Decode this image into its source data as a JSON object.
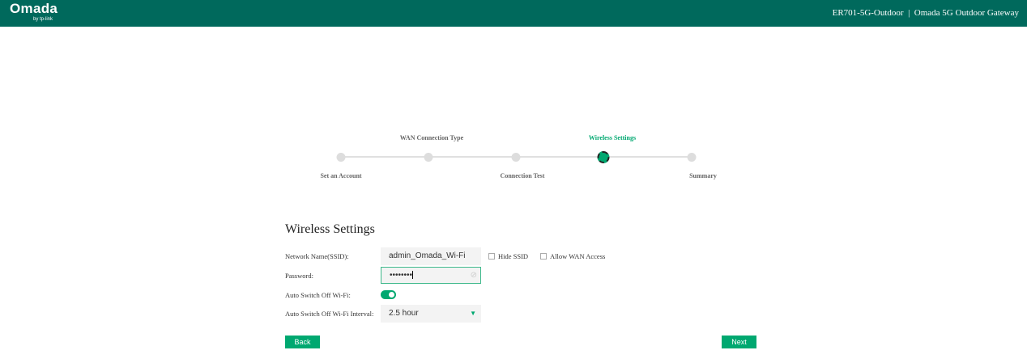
{
  "header": {
    "logo": "Omada",
    "logo_sub": "by tp-link",
    "device": "ER701-5G-Outdoor  |  Omada 5G Outdoor Gateway"
  },
  "steps": [
    {
      "label": "Set an Account"
    },
    {
      "label": "WAN Connection Type"
    },
    {
      "label": "Connection Test"
    },
    {
      "label": "Wireless Settings",
      "active": true
    },
    {
      "label": "Summary"
    }
  ],
  "form": {
    "title": "Wireless Settings",
    "ssid_label": "Network Name(SSID):",
    "ssid_value": "admin_Omada_Wi-Fi",
    "hide_ssid": "Hide SSID",
    "allow_wan": "Allow WAN Access",
    "password_label": "Password:",
    "password_value": "••••••••",
    "auto_off_label": "Auto Switch Off Wi-Fi:",
    "auto_off_on": true,
    "interval_label": "Auto Switch Off Wi-Fi Interval:",
    "interval_value": "2.5 hour"
  },
  "buttons": {
    "back": "Back",
    "next": "Next"
  },
  "colors": {
    "header": "#00695c",
    "accent": "#00a870"
  }
}
